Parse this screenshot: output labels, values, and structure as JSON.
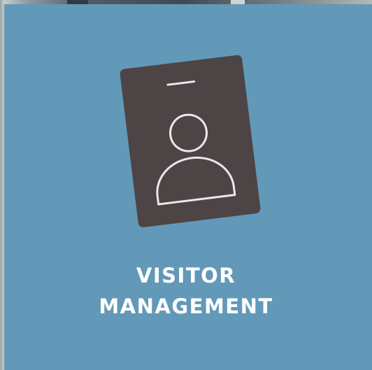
{
  "tile": {
    "title_line1": "VISITOR",
    "title_line2": "MANAGEMENT",
    "icon": "visitor-badge-icon"
  },
  "colors": {
    "tile_background": "#6299b8",
    "badge_fill": "#4d4446",
    "badge_stroke": "#efe6e8",
    "title_text": "#ffffff"
  }
}
